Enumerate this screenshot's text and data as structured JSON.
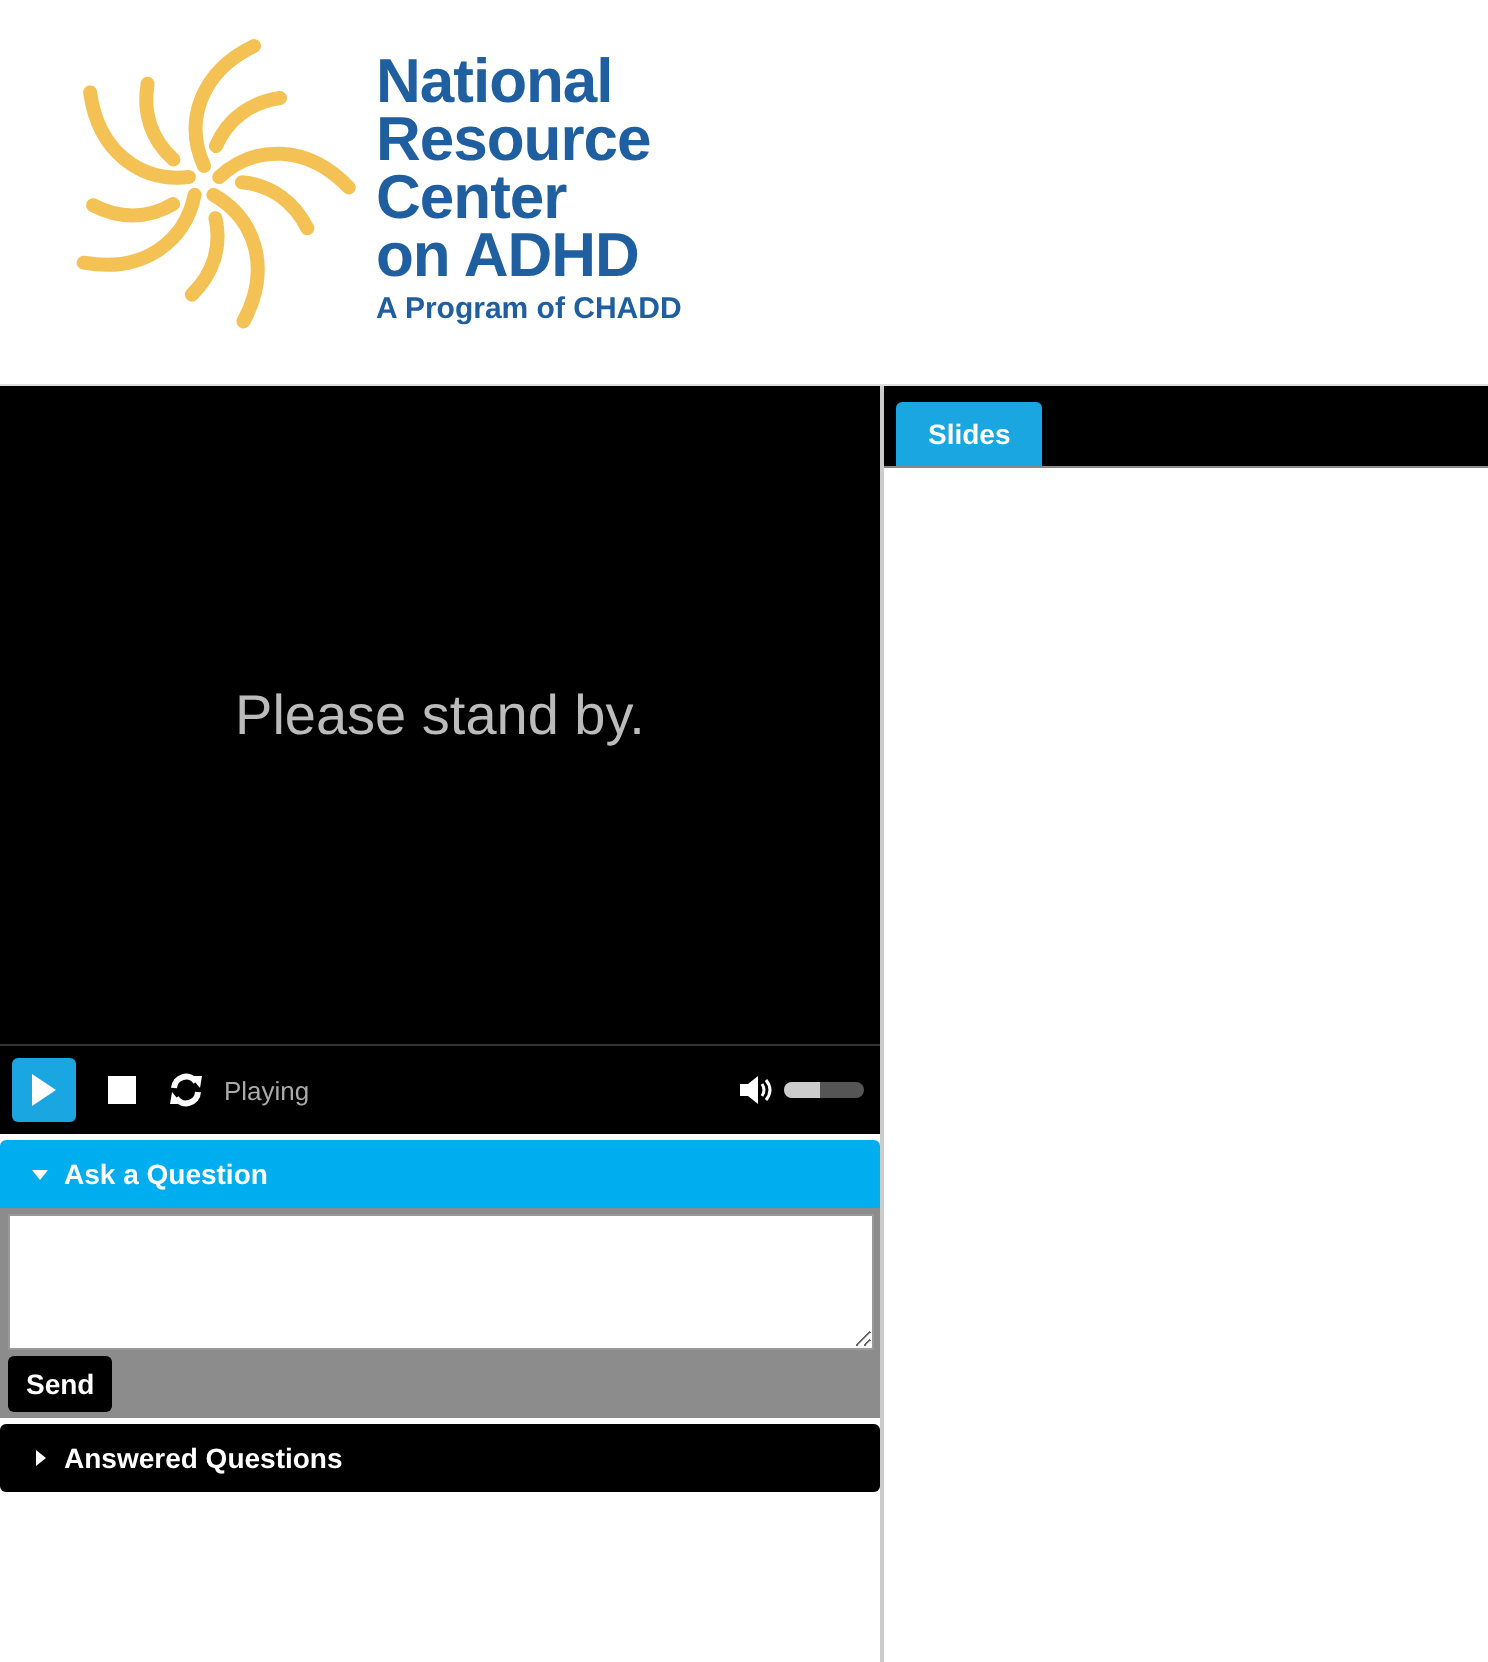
{
  "logo": {
    "title_lines": [
      "National",
      "Resource",
      "Center",
      "on ADHD"
    ],
    "subtitle": "A Program of CHADD"
  },
  "player": {
    "message": "Please stand by.",
    "status": "Playing",
    "volume": {
      "level": 0.45
    }
  },
  "panels": [
    {
      "title": "Ask a Question",
      "expanded": true,
      "button": "Send"
    },
    {
      "title": "Answered Questions",
      "expanded": false
    }
  ],
  "tabs": [
    {
      "label": "Slides",
      "selected": true
    }
  ]
}
